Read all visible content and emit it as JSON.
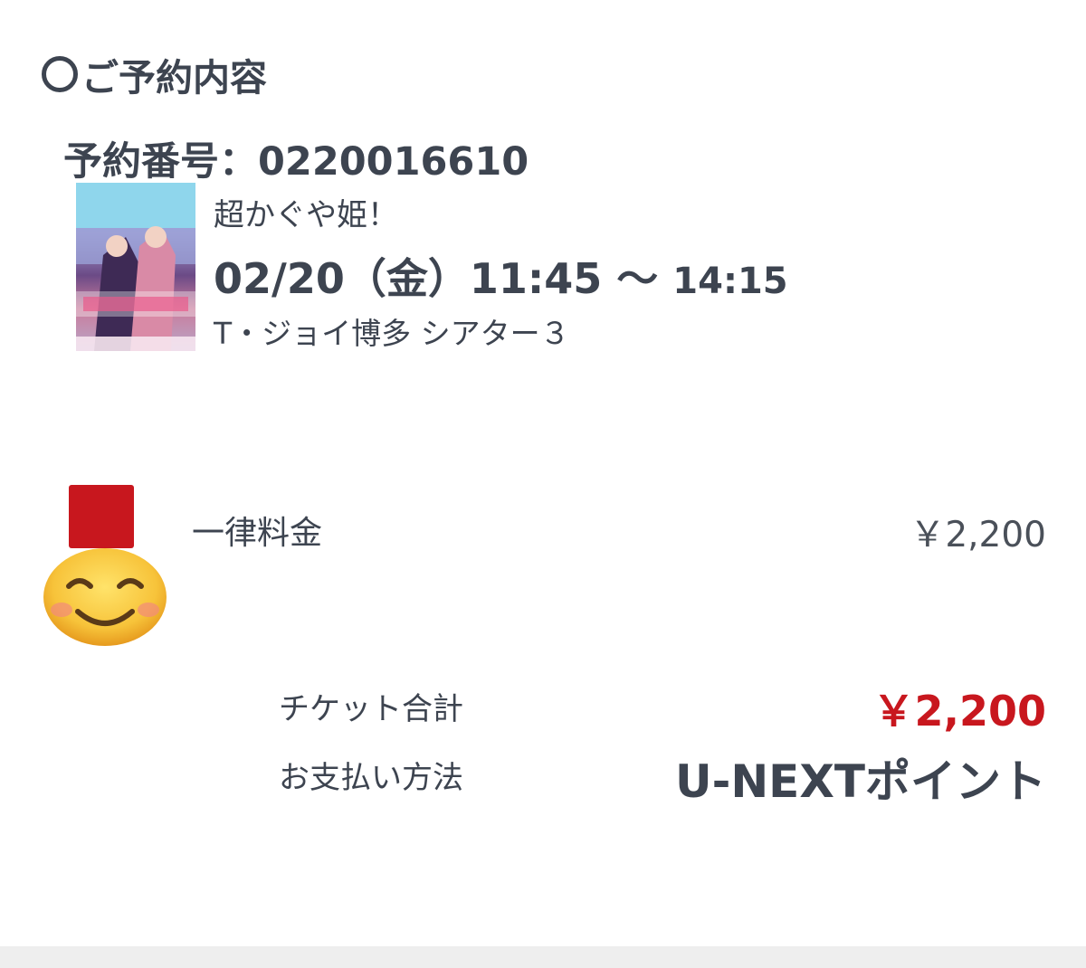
{
  "section": {
    "title": "ご予約内容",
    "icon": "circle-icon"
  },
  "reservation": {
    "number_text": "予約番号：0220016610"
  },
  "movie": {
    "poster_icon": "movie-poster-image",
    "title": "超かぐや姫！",
    "showtime_start": "02/20（金）11:45 〜",
    "showtime_end": "14:15",
    "theater": "T・ジョイ博多 シアター３"
  },
  "sticker": {
    "icon": "smiling-face-medal-icon"
  },
  "pricing": {
    "fare_label": "一律料金",
    "fare_value": "￥2,200",
    "total_label": "チケット合計",
    "total_value": "￥2,200",
    "payment_label": "お支払い方法",
    "payment_value": "U-NEXTポイント"
  },
  "colors": {
    "text": "#3d4450",
    "accent_red": "#c8171e",
    "bottom_bar": "#eeeeee"
  }
}
